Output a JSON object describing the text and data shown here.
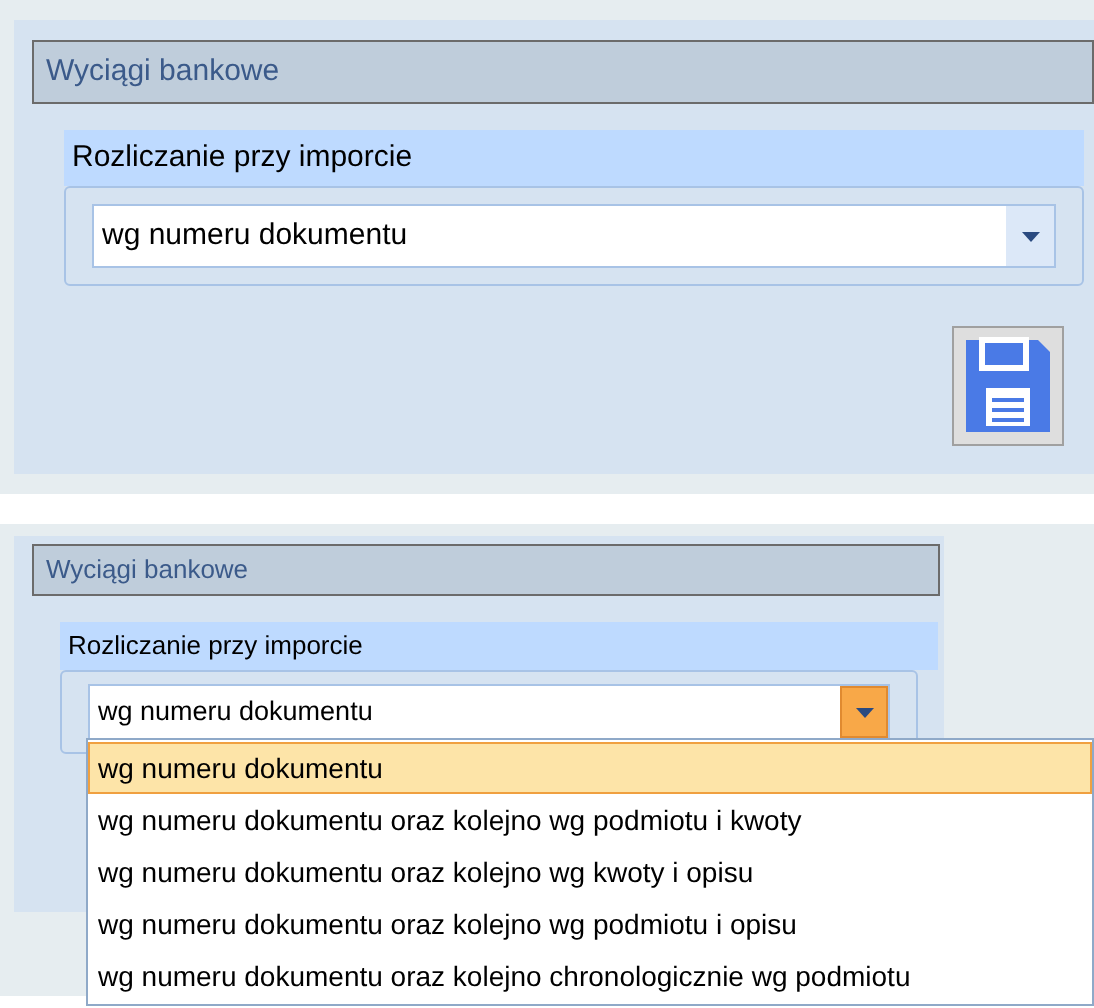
{
  "panels": [
    {
      "title": "Wyciągi bankowe",
      "group_label": "Rozliczanie przy imporcie",
      "combo": {
        "value": "wg numeru dokumentu",
        "expanded": false
      },
      "save_button": true
    },
    {
      "title": "Wyciągi bankowe",
      "group_label": "Rozliczanie przy imporcie",
      "combo": {
        "value": "wg numeru dokumentu",
        "expanded": true,
        "options": [
          {
            "label": "wg numeru dokumentu",
            "selected": true
          },
          {
            "label": "wg numeru dokumentu oraz kolejno wg podmiotu i kwoty",
            "selected": false
          },
          {
            "label": "wg numeru dokumentu oraz kolejno wg kwoty i opisu",
            "selected": false
          },
          {
            "label": "wg numeru dokumentu oraz kolejno wg podmiotu i opisu",
            "selected": false
          },
          {
            "label": "wg numeru dokumentu oraz kolejno chronologicznie wg podmiotu",
            "selected": false
          }
        ]
      },
      "save_button": false
    }
  ]
}
